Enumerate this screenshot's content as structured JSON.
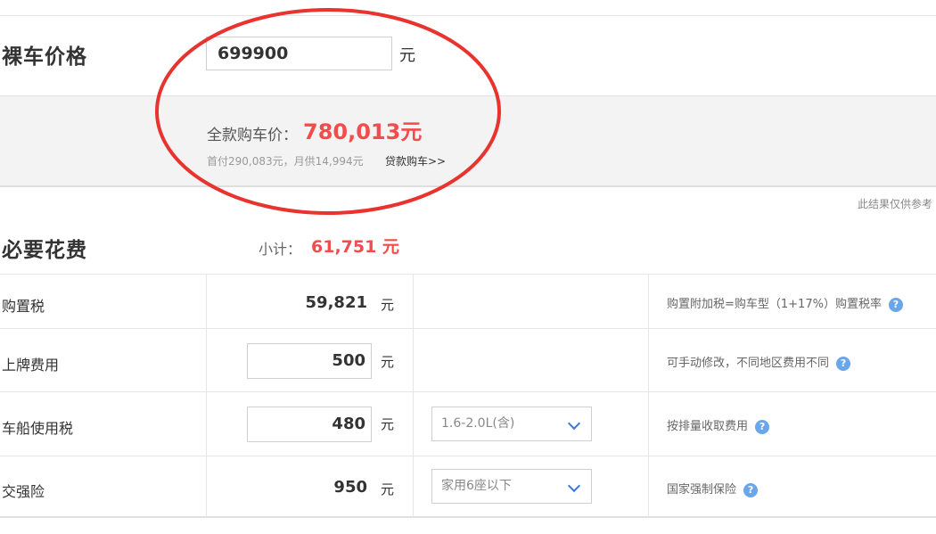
{
  "price": {
    "title": "裸车价格",
    "input_value": "699900",
    "unit": "元"
  },
  "total": {
    "label": "全款购车价：",
    "value": "780,013元",
    "loan_text": "首付290,083元，月供14,994元",
    "loan_link": "贷款购车>>"
  },
  "note": "此结果仅供参考",
  "required": {
    "title": "必要花费",
    "subtotal_label": "小计：",
    "subtotal_value": "61,751 元"
  },
  "rows": [
    {
      "label": "购置税",
      "value": "59,821",
      "unit": "元",
      "select": "",
      "hint": "购置附加税=购车型（1+17%）购置税率",
      "help": "?"
    },
    {
      "label": "上牌费用",
      "value": "500",
      "unit": "元",
      "select": "",
      "hint": "可手动修改，不同地区费用不同",
      "help": "?"
    },
    {
      "label": "车船使用税",
      "value": "480",
      "unit": "元",
      "select": "1.6-2.0L(含)",
      "hint": "按排量收取费用",
      "help": "?"
    },
    {
      "label": "交强险",
      "value": "950",
      "unit": "元",
      "select": "家用6座以下",
      "hint": "国家强制保险",
      "help": "?"
    }
  ],
  "colors": {
    "accent_red": "#f34c4c",
    "help_blue": "#6aa6ea",
    "annotation": "#e8332f"
  }
}
